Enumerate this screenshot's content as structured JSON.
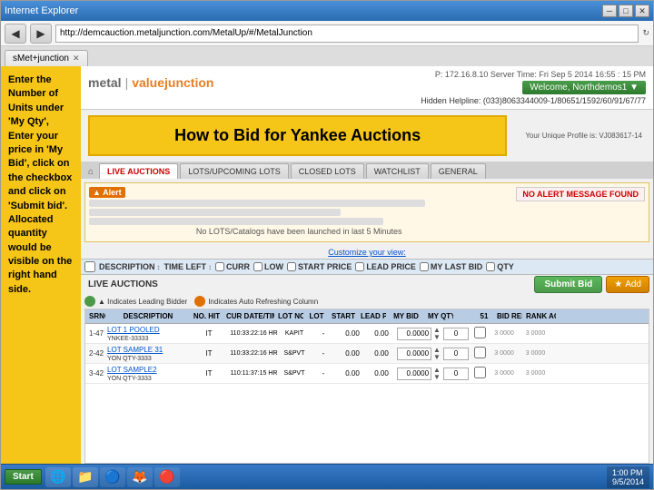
{
  "browser": {
    "address": "http://demcauction.metaljunction.com/MetalUp/#/MetalJunction",
    "tab_label": "sMet+junction",
    "title_bar": "Internet Explorer",
    "buttons": {
      "minimize": "─",
      "maximize": "□",
      "close": "✕"
    },
    "nav": {
      "back": "◀",
      "forward": "▶"
    }
  },
  "header": {
    "logo_metal": "metal",
    "logo_pipe": "|",
    "logo_value": "valuejunction",
    "ip_info": "P: 172.16.8.10 Server Time: Fri Sep 5 2014 16:55 : 15 PM",
    "welcome": "Welcome, Northdemos1 ▼",
    "helpline": "Hidden Helpline: (033)8063344009-1/80651/1592/60/91/67/77",
    "user_info": "Your Unique Profile is: VJ083617-14"
  },
  "title_banner": "How to Bid for Yankee Auctions",
  "left_sidebar": {
    "text": "Enter the Number of Units under 'My Qty', Enter your price in 'My Bid', click on the checkbox and click on 'Submit bid'. Allocated quantity would be visible on the right hand side."
  },
  "nav_tabs": {
    "home_icon": "⌂",
    "items": [
      {
        "label": "LIVE AUCTIONS",
        "active": true
      },
      {
        "label": "LOTS/UPCOMING LOTS",
        "active": false
      },
      {
        "label": "CLOSED LOTS",
        "active": false
      },
      {
        "label": "WATCHLIST",
        "active": false
      },
      {
        "label": "GENERAL",
        "active": false
      }
    ]
  },
  "alert_section": {
    "badge": "▲ Alert",
    "no_message": "NO ALERT MESSAGE FOUND",
    "no_lots_msg": "No LOTS/Catalogs have been launched in last 5 Minutes",
    "customize": "Customize your view:"
  },
  "column_headers": [
    {
      "label": "DESCRIPTION",
      "id": "col-desc"
    },
    {
      "label": "TIME LEFT",
      "id": "col-time"
    },
    {
      "label": "CURR",
      "id": "col-curr"
    },
    {
      "label": "LOW",
      "id": "col-low"
    },
    {
      "label": "START PRICE",
      "id": "col-start"
    },
    {
      "label": "LEAD PRICE",
      "id": "col-lead"
    },
    {
      "label": "MY LAST BID",
      "id": "col-mybid"
    },
    {
      "label": "QTY",
      "id": "col-qty"
    }
  ],
  "section_live": "LIVE AUCTIONS",
  "legend": {
    "green_label": "▲ Indicates Leading Bidder",
    "blue_label": "Indicates Auto Refreshing Column"
  },
  "buttons": {
    "submit_bid": "Submit Bid",
    "add": "Add",
    "add_icon": "★"
  },
  "table_headers": [
    "SRNO.",
    "DESCRIPTION",
    "NO. HIT",
    "CUR DATE/TIME",
    "LOT NO.",
    "LOT",
    "START PRICE",
    "LEAD PRICE",
    "MY BID",
    "MY QTY",
    "",
    "51",
    "BID RESULT",
    "RANK",
    "ACTIVE/INACTIVE"
  ],
  "auction_rows": [
    {
      "num": "1-47",
      "desc": "LOT 1 POOLED",
      "lot_desc": "YNKEE-33333",
      "time": "110:33:22:16 HR",
      "curr": "KAPIT",
      "low": "-",
      "start": "0.00",
      "lead": "0.00",
      "my_bid": "0.0000",
      "my_qty": "0",
      "result": "3 0000"
    },
    {
      "num": "2-42",
      "desc": "LOT SAMPLE 31",
      "lot_desc": "YON QTY-3333",
      "time": "110:33:22:16 HR",
      "curr": "S&PVT",
      "low": "-",
      "start": "0.00",
      "lead": "0.00",
      "my_bid": "0.0000",
      "my_qty": "0",
      "result": "3 0000"
    },
    {
      "num": "3-42",
      "desc": "LOT SAMPLE2",
      "lot_desc": "YON QTY-3333",
      "time": "110:11:37:15 HR",
      "curr": "S&PVT",
      "low": "-",
      "start": "0.00",
      "lead": "0.00",
      "my_bid": "0.0000",
      "my_qty": "0",
      "result": "3 0000"
    }
  ],
  "taskbar": {
    "start": "Start",
    "time": "1:00 PM",
    "date": "9/5/2014",
    "apps": [
      "🌐",
      "📁",
      "🔵",
      "🧡",
      "🔴"
    ]
  }
}
